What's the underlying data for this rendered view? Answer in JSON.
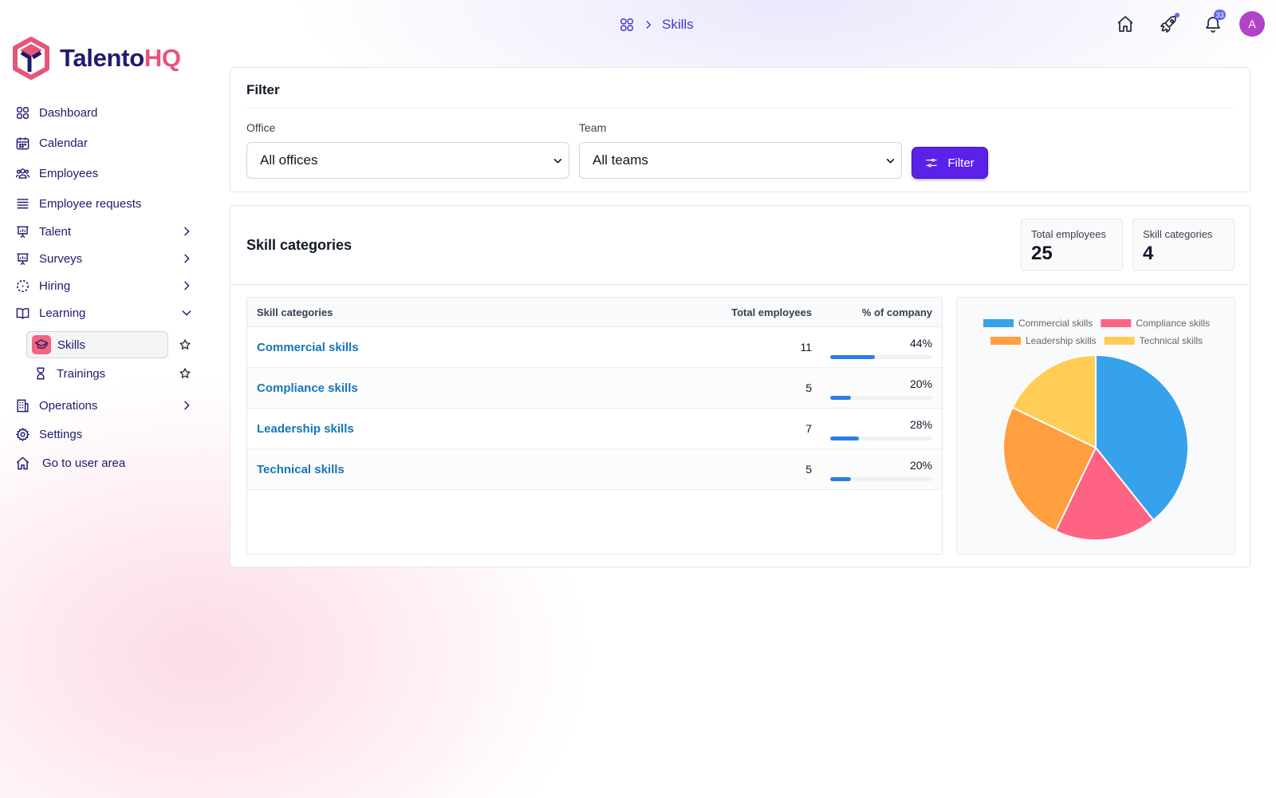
{
  "brand": {
    "name_part1": "Talento",
    "name_part2": "HQ"
  },
  "sidebar": {
    "items": [
      {
        "label": "Dashboard",
        "icon": "grid-icon"
      },
      {
        "label": "Calendar",
        "icon": "calendar-icon"
      },
      {
        "label": "Employees",
        "icon": "users-icon"
      },
      {
        "label": "Employee requests",
        "icon": "list-icon"
      },
      {
        "label": "Talent",
        "icon": "presentation-chart-icon",
        "expandable": true
      },
      {
        "label": "Surveys",
        "icon": "presentation-chart-icon",
        "expandable": true
      },
      {
        "label": "Hiring",
        "icon": "dashed-circle-icon",
        "expandable": true
      },
      {
        "label": "Learning",
        "icon": "book-icon",
        "expanded": true
      },
      {
        "label": "Operations",
        "icon": "building-icon",
        "expandable": true
      },
      {
        "label": "Settings",
        "icon": "gear-icon"
      },
      {
        "label": "Go to user area",
        "icon": "home-icon"
      }
    ],
    "learning_subitems": [
      {
        "label": "Skills",
        "icon": "graduation-cap-icon",
        "active": true
      },
      {
        "label": "Trainings",
        "icon": "trophy-icon"
      }
    ]
  },
  "breadcrumb": {
    "current": "Skills"
  },
  "header": {
    "notification_count": "33",
    "avatar_initial": "A"
  },
  "filter": {
    "title": "Filter",
    "office_label": "Office",
    "office_value": "All offices",
    "team_label": "Team",
    "team_value": "All teams",
    "button_label": "Filter"
  },
  "skills": {
    "title": "Skill categories",
    "stats": [
      {
        "label": "Total employees",
        "value": "25"
      },
      {
        "label": "Skill categories",
        "value": "4"
      }
    ],
    "columns": [
      "Skill categories",
      "Total employees",
      "% of company"
    ],
    "rows": [
      {
        "category": "Commercial skills",
        "employees": "11",
        "percent": "44%",
        "fraction": 0.44
      },
      {
        "category": "Compliance skills",
        "employees": "5",
        "percent": "20%",
        "fraction": 0.2
      },
      {
        "category": "Leadership skills",
        "employees": "7",
        "percent": "28%",
        "fraction": 0.28
      },
      {
        "category": "Technical skills",
        "employees": "5",
        "percent": "20%",
        "fraction": 0.2
      }
    ]
  },
  "chart_data": {
    "type": "pie",
    "categories": [
      "Commercial skills",
      "Compliance skills",
      "Leadership skills",
      "Technical skills"
    ],
    "values": [
      11,
      5,
      7,
      5
    ],
    "colors": [
      "#36a2eb",
      "#ff6384",
      "#ff9f40",
      "#ffcd56"
    ],
    "legend": "top"
  }
}
